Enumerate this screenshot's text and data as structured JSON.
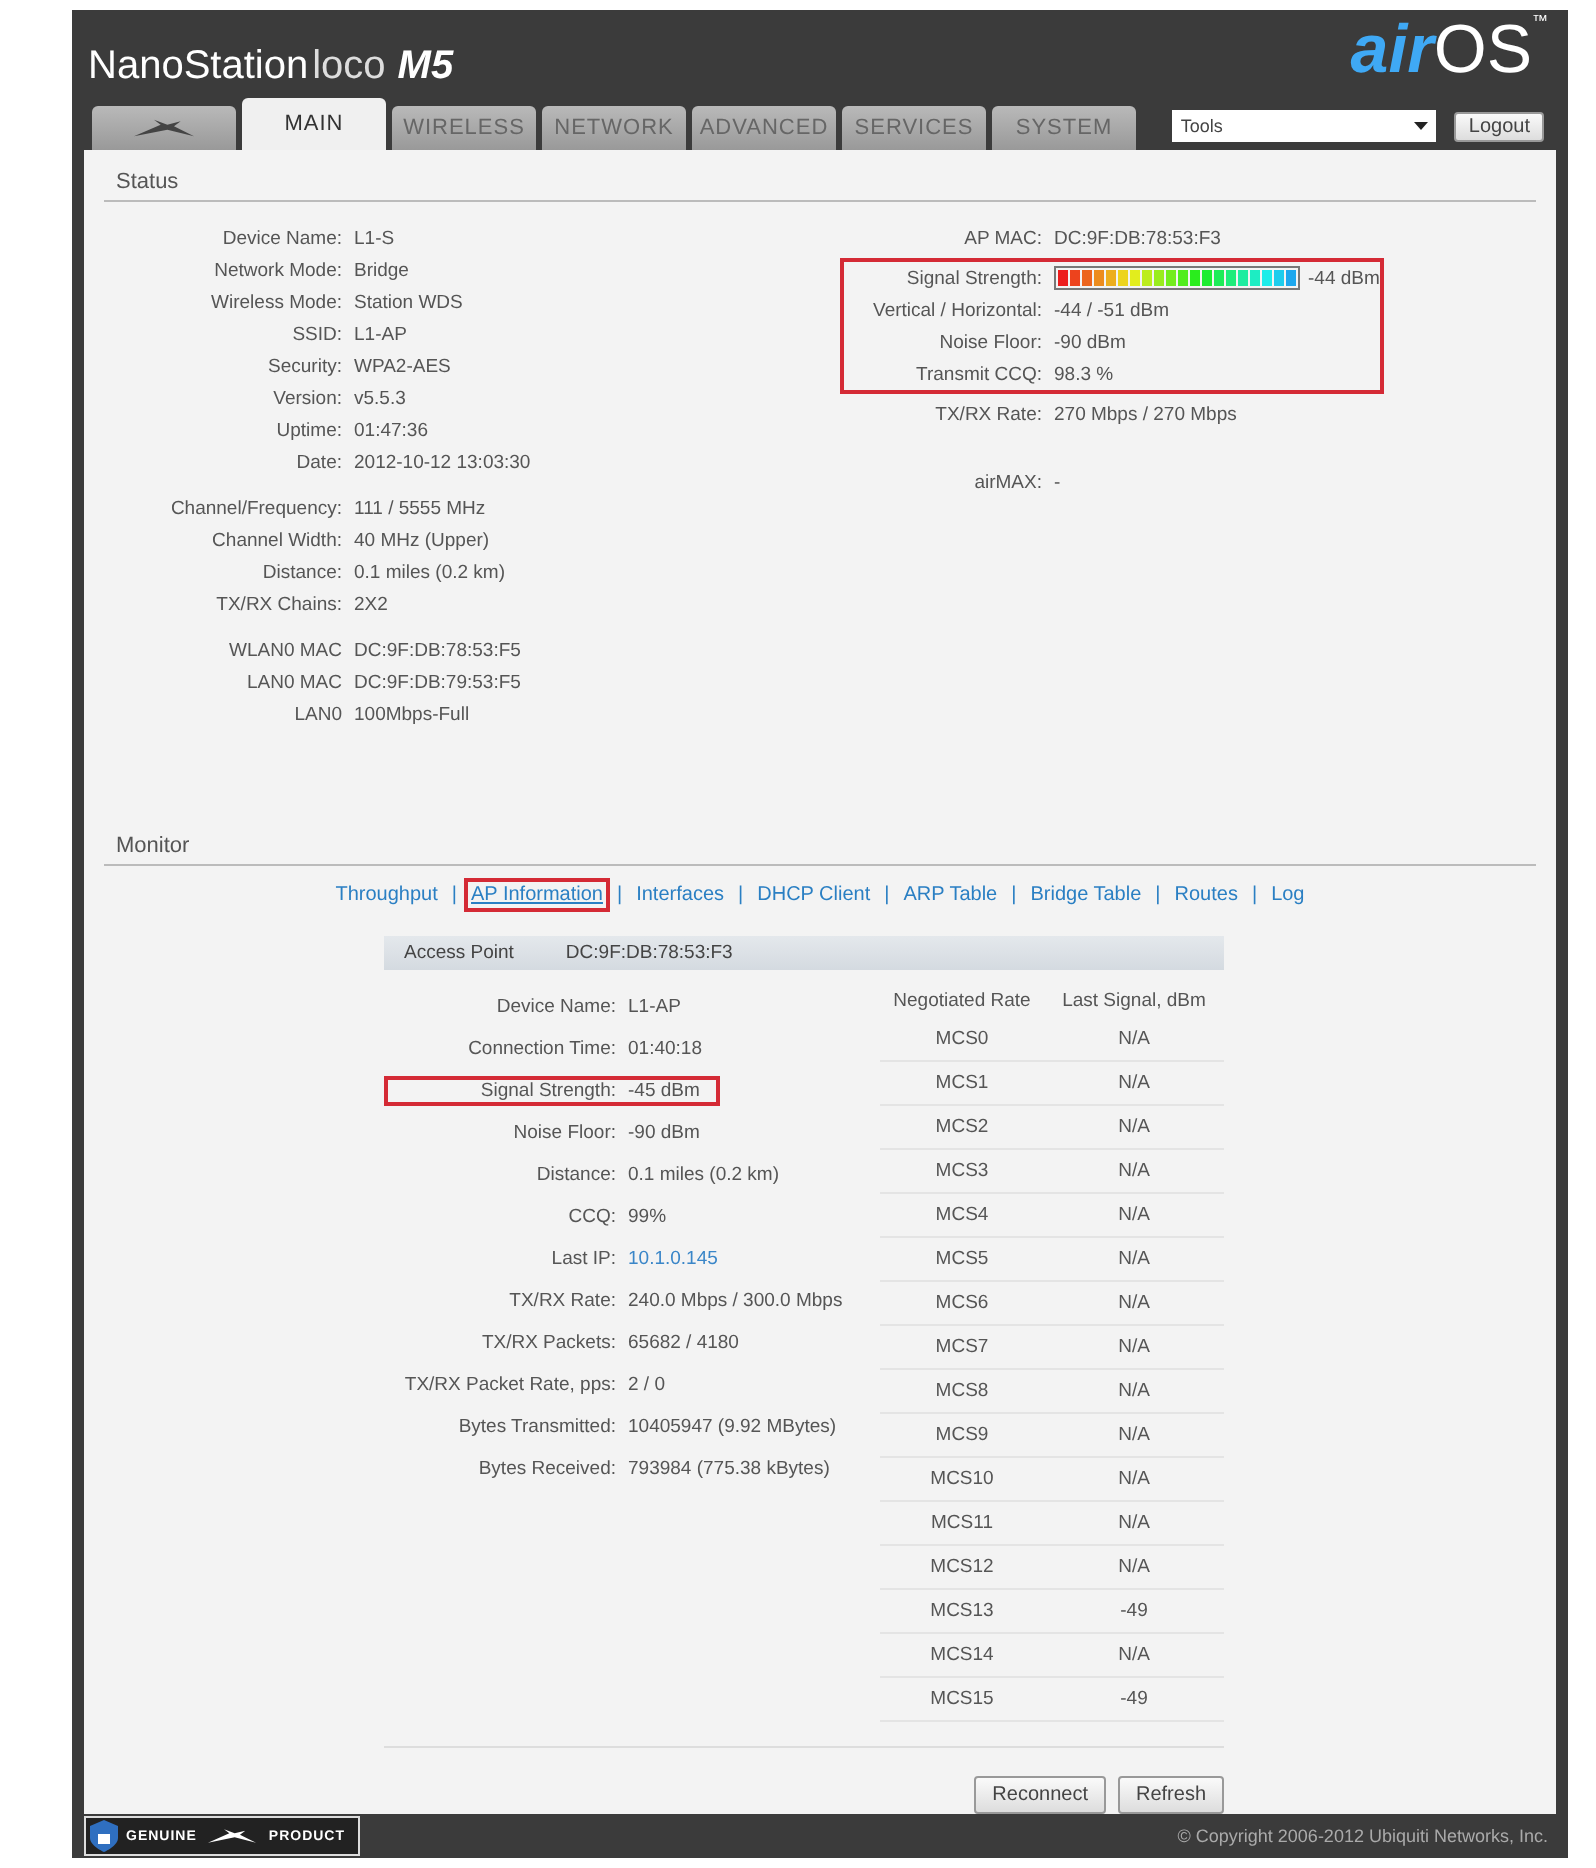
{
  "header": {
    "product": {
      "name": "NanoStation",
      "model": "loco",
      "variant": "M5"
    },
    "brand": {
      "prefix": "air",
      "suffix": "OS",
      "mark": "™"
    }
  },
  "tabs": [
    {
      "kind": "logo",
      "selected": false
    },
    {
      "label": "MAIN",
      "selected": true
    },
    {
      "label": "WIRELESS",
      "selected": false
    },
    {
      "label": "NETWORK",
      "selected": false
    },
    {
      "label": "ADVANCED",
      "selected": false
    },
    {
      "label": "SERVICES",
      "selected": false
    },
    {
      "label": "SYSTEM",
      "selected": false
    }
  ],
  "tools_select": {
    "value": "Tools"
  },
  "logout_button": "Logout",
  "status": {
    "title": "Status",
    "left_groups": [
      [
        {
          "label": "Device Name:",
          "value": "L1-S"
        },
        {
          "label": "Network Mode:",
          "value": "Bridge"
        },
        {
          "label": "Wireless Mode:",
          "value": "Station WDS"
        },
        {
          "label": "SSID:",
          "value": "L1-AP"
        },
        {
          "label": "Security:",
          "value": "WPA2-AES"
        },
        {
          "label": "Version:",
          "value": "v5.5.3"
        },
        {
          "label": "Uptime:",
          "value": "01:47:36"
        },
        {
          "label": "Date:",
          "value": "2012-10-12 13:03:30"
        }
      ],
      [
        {
          "label": "Channel/Frequency:",
          "value": "111 / 5555 MHz"
        },
        {
          "label": "Channel Width:",
          "value": "40 MHz (Upper)"
        },
        {
          "label": "Distance:",
          "value": "0.1 miles (0.2 km)"
        },
        {
          "label": "TX/RX Chains:",
          "value": "2X2"
        }
      ],
      [
        {
          "label": "WLAN0 MAC",
          "value": "DC:9F:DB:78:53:F5"
        },
        {
          "label": "LAN0 MAC",
          "value": "DC:9F:DB:79:53:F5"
        },
        {
          "label": "LAN0",
          "value": "100Mbps-Full"
        }
      ]
    ],
    "right_sections": [
      [
        {
          "highlighted": false,
          "rows": [
            {
              "label": "AP MAC:",
              "value": "DC:9F:DB:78:53:F3"
            }
          ]
        },
        {
          "highlighted": true,
          "rows": [
            {
              "label": "Signal Strength:",
              "kind": "meter",
              "value": "-44 dBm"
            },
            {
              "label": "Vertical / Horizontal:",
              "value": "-44 / -51 dBm"
            },
            {
              "label": "Noise Floor:",
              "value": "-90 dBm"
            },
            {
              "label": "Transmit CCQ:",
              "value": "98.3 %"
            }
          ]
        },
        {
          "highlighted": false,
          "rows": [
            {
              "label": "TX/RX Rate:",
              "value": "270 Mbps / 270 Mbps"
            }
          ]
        }
      ],
      [
        {
          "highlighted": false,
          "rows": [
            {
              "label": "airMAX:",
              "value": "-"
            }
          ]
        }
      ]
    ]
  },
  "monitor": {
    "title": "Monitor",
    "separator": "|",
    "links": [
      {
        "label": "Throughput",
        "selected": false,
        "highlighted": false
      },
      {
        "label": "AP Information",
        "selected": true,
        "highlighted": true
      },
      {
        "label": "Interfaces",
        "selected": false,
        "highlighted": false
      },
      {
        "label": "DHCP Client",
        "selected": false,
        "highlighted": false
      },
      {
        "label": "ARP Table",
        "selected": false,
        "highlighted": false
      },
      {
        "label": "Bridge Table",
        "selected": false,
        "highlighted": false
      },
      {
        "label": "Routes",
        "selected": false,
        "highlighted": false
      },
      {
        "label": "Log",
        "selected": false,
        "highlighted": false
      }
    ],
    "access_point": {
      "label": "Access Point",
      "value": "DC:9F:DB:78:53:F3"
    },
    "details": [
      {
        "label": "Device Name:",
        "value": "L1-AP",
        "highlighted": false
      },
      {
        "label": "Connection Time:",
        "value": "01:40:18",
        "highlighted": false
      },
      {
        "label": "Signal Strength:",
        "value": "-45 dBm",
        "highlighted": true
      },
      {
        "label": "Noise Floor:",
        "value": "-90 dBm",
        "highlighted": false
      },
      {
        "label": "Distance:",
        "value": "0.1 miles (0.2 km)",
        "highlighted": false
      },
      {
        "label": "CCQ:",
        "value": "99%",
        "highlighted": false
      },
      {
        "label": "Last IP:",
        "value": "10.1.0.145",
        "highlighted": false,
        "kind": "link"
      },
      {
        "label": "TX/RX Rate:",
        "value": "240.0 Mbps / 300.0 Mbps",
        "highlighted": false
      },
      {
        "label": "TX/RX Packets:",
        "value": "65682 / 4180",
        "highlighted": false
      },
      {
        "label": "TX/RX Packet Rate, pps:",
        "value": "2 / 0",
        "highlighted": false
      },
      {
        "label": "Bytes Transmitted:",
        "value": "10405947 (9.92 MBytes)",
        "highlighted": false
      },
      {
        "label": "Bytes Received:",
        "value": "793984 (775.38 kBytes)",
        "highlighted": false
      }
    ],
    "rates_columns": [
      "Negotiated Rate",
      "Last Signal, dBm"
    ],
    "rates": [
      [
        "MCS0",
        "N/A"
      ],
      [
        "MCS1",
        "N/A"
      ],
      [
        "MCS2",
        "N/A"
      ],
      [
        "MCS3",
        "N/A"
      ],
      [
        "MCS4",
        "N/A"
      ],
      [
        "MCS5",
        "N/A"
      ],
      [
        "MCS6",
        "N/A"
      ],
      [
        "MCS7",
        "N/A"
      ],
      [
        "MCS8",
        "N/A"
      ],
      [
        "MCS9",
        "N/A"
      ],
      [
        "MCS10",
        "N/A"
      ],
      [
        "MCS11",
        "N/A"
      ],
      [
        "MCS12",
        "N/A"
      ],
      [
        "MCS13",
        "-49"
      ],
      [
        "MCS14",
        "N/A"
      ],
      [
        "MCS15",
        "-49"
      ]
    ],
    "buttons": [
      "Reconnect",
      "Refresh"
    ]
  },
  "footer": {
    "badge": [
      "GENUINE",
      "PRODUCT"
    ],
    "copyright": "© Copyright 2006-2012 Ubiquiti Networks, Inc."
  }
}
